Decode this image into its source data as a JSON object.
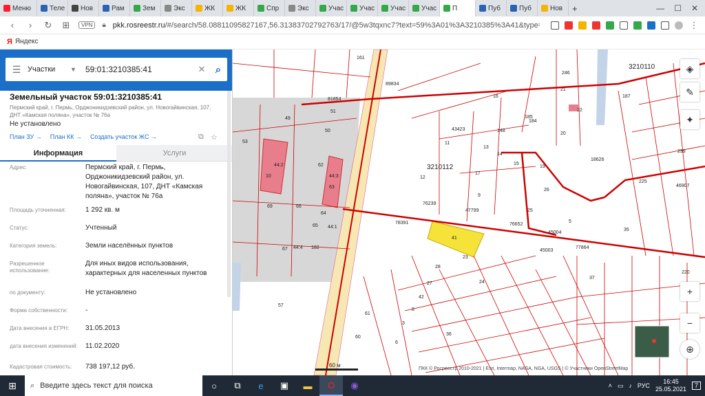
{
  "browser": {
    "tabs": [
      {
        "label": "Меню",
        "color": "#ff1b2d"
      },
      {
        "label": "Теле",
        "color": "#2b63b3"
      },
      {
        "label": "Нов",
        "color": "#444444"
      },
      {
        "label": "Рам",
        "color": "#2b63b3"
      },
      {
        "label": "Зем",
        "color": "#35a84b"
      },
      {
        "label": "Экс",
        "color": "#888888"
      },
      {
        "label": "ЖК",
        "color": "#f4b400"
      },
      {
        "label": "ЖК",
        "color": "#f4b400"
      },
      {
        "label": "Спр",
        "color": "#35a84b"
      },
      {
        "label": "Экс",
        "color": "#888888"
      },
      {
        "label": "Учас",
        "color": "#35a84b"
      },
      {
        "label": "Учас",
        "color": "#35a84b"
      },
      {
        "label": "Учас",
        "color": "#35a84b"
      },
      {
        "label": "Учас",
        "color": "#35a84b"
      },
      {
        "label": "П",
        "color": "#35a84b"
      },
      {
        "label": "Пуб",
        "color": "#2b63b3"
      },
      {
        "label": "Пуб",
        "color": "#2b63b3"
      },
      {
        "label": "Нов",
        "color": "#f4b400"
      }
    ],
    "new_tab": "+",
    "url_host": "pkk.rosreestr.ru",
    "url_rest": "/#/search/58.08811095827167,56.31383702792763/17/@5w3tqxnc7?text=59%3A01%3A3210385%3A41&type=1&",
    "vpn": "VPN",
    "bookmark": "Яндекс"
  },
  "search": {
    "type": "Участки",
    "query": "59:01:3210385:41"
  },
  "parcel": {
    "title": "Земельный участок 59:01:3210385:41",
    "address_short": "Пермский край, г. Пермь, Орджоникидзевский район, ул. Новогайвинская, 107, ДНТ «Камская поляна», участок № 76а",
    "status_top": "Не установлено",
    "link_zu": "План ЗУ →",
    "link_kk": "План КК →",
    "link_create": "Создать участок ЖС →"
  },
  "tabs": {
    "info": "Информация",
    "services": "Услуги"
  },
  "info_rows": [
    {
      "label": "Адрес:",
      "value": "Пермский край, г. Пермь, Орджоникидзевский район, ул. Новогайвинская, 107, ДНТ «Камская поляна», участок № 76а"
    },
    {
      "label": "Площадь уточненная:",
      "value": "1 292 кв. м"
    },
    {
      "label": "Статус:",
      "value": "Учтенный"
    },
    {
      "label": "Категория земель:",
      "value": "Земли населённых пунктов"
    },
    {
      "label": "Разрешенное использование:",
      "value": "Для иных видов использования, характерных для населенных пунктов"
    },
    {
      "label": "по документу:",
      "value": "Не установлено"
    },
    {
      "label": "Форма собственности:",
      "value": "-"
    },
    {
      "label": "Дата внесения в ЕГРН:",
      "value": "31.05.2013"
    },
    {
      "label": "дата внесения изменений:",
      "value": "11.02.2020"
    },
    {
      "label": "Кадастровая стоимость:",
      "value": "738 197,12 руб."
    }
  ],
  "map": {
    "labels": {
      "q1": "3210110",
      "q2": "3210112",
      "n161": "161",
      "n89834": "89834",
      "n81854": "81854",
      "n16": "16",
      "n21": "21",
      "n22": "22",
      "n246": "246",
      "n20": "20",
      "n187": "187",
      "n185": "185",
      "n184": "184",
      "n49": "49",
      "n51": "51",
      "n50": "50",
      "n53": "53",
      "n10": "10",
      "n442": "44:2",
      "n62": "62",
      "n443": "44:3",
      "n63": "63",
      "n69": "69",
      "n66": "66",
      "n64": "64",
      "n65": "65",
      "n441": "44:1",
      "n67": "67",
      "n444": "44:4",
      "n182": "182",
      "n57": "57",
      "n43423": "43423",
      "n11": "11",
      "n12": "12",
      "n148": "148",
      "n13": "13",
      "n14": "14",
      "n15": "15",
      "n19": "19",
      "n17": "17",
      "n9": "9",
      "n76239": "76239",
      "n47799": "47799",
      "n78391": "78391",
      "n41": "41",
      "n76652": "76652",
      "n45004": "45004",
      "n45003": "45003",
      "n77864": "77864",
      "n18626": "18626",
      "n225": "225",
      "n46907": "46907",
      "n239": "239",
      "n35": "35",
      "n37": "37",
      "n220": "220",
      "n61": "61",
      "n60": "60",
      "n36": "36",
      "n28": "28",
      "n27": "27",
      "n42": "42",
      "n8": "8",
      "n3": "3",
      "n6": "6",
      "n24": "24",
      "n23": "23",
      "n26": "26",
      "n25": "25",
      "n5": "5"
    },
    "scale": "60 м",
    "attribution": "ПКК © Росреестр 2010-2021 | Esri, Intermap, NASA, NGA, USGS | © Участники OpenStreetMap"
  },
  "taskbar": {
    "search_placeholder": "Введите здесь текст для поиска",
    "lang": "РУС",
    "time": "16:45",
    "date": "25.05.2021",
    "notif": "7"
  }
}
